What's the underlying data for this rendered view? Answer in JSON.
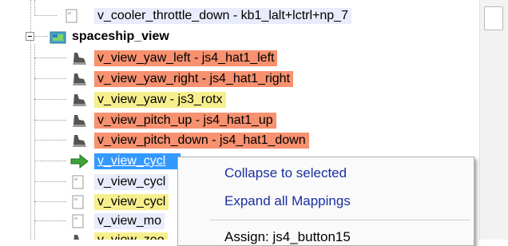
{
  "tree": {
    "rows": [
      {
        "label": "v_cooler_throttle_down - kb1_lalt+lctrl+np_7",
        "style": "blue",
        "icon": "blank-doc-icon"
      },
      {
        "label": "spaceship_view",
        "style": "bold",
        "icon": "folder-image-icon"
      },
      {
        "label": "v_view_yaw_left - js4_hat1_left",
        "style": "orange",
        "icon": "joystick-icon"
      },
      {
        "label": "v_view_yaw_right - js4_hat1_right",
        "style": "orange",
        "icon": "joystick-icon"
      },
      {
        "label": "v_view_yaw - js3_rotx",
        "style": "yellow",
        "icon": "joystick-icon"
      },
      {
        "label": "v_view_pitch_up - js4_hat1_up",
        "style": "orange",
        "icon": "joystick-icon"
      },
      {
        "label": "v_view_pitch_down - js4_hat1_down",
        "style": "orange",
        "icon": "joystick-icon"
      },
      {
        "label": "v_view_cycl",
        "style": "sel",
        "icon": "green-arrow-icon"
      },
      {
        "label": "v_view_cycl",
        "style": "blue",
        "icon": "blank-doc-icon"
      },
      {
        "label": "v_view_cycl",
        "style": "yellow",
        "icon": "blank-doc-icon"
      },
      {
        "label": "v_view_mo",
        "style": "blue",
        "icon": "blank-doc-icon"
      },
      {
        "label": "v_view_zoo",
        "style": "yellow",
        "icon": "joystick-icon"
      }
    ]
  },
  "context_menu": {
    "items": [
      "Collapse to selected",
      "Expand all Mappings",
      "Assign: js4_button15"
    ]
  },
  "colors": {
    "orange": "#f7916f",
    "yellow": "#f7ef8d",
    "blue": "#e8ecfb",
    "selected": "#3399ff"
  }
}
